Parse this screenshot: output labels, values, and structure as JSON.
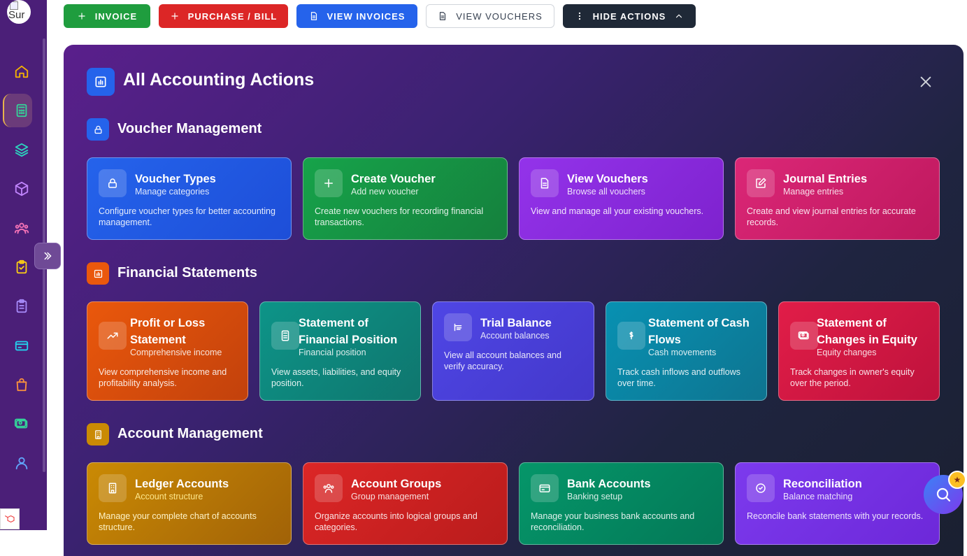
{
  "app": {
    "logo_alt": "Sur"
  },
  "toolbar": {
    "invoice": "INVOICE",
    "purchase": "PURCHASE / BILL",
    "view_invoices": "VIEW INVOICES",
    "view_vouchers": "VIEW VOUCHERS",
    "hide_actions": "HIDE ACTIONS"
  },
  "panel": {
    "title": "All Accounting Actions",
    "sections": {
      "voucher": {
        "title": "Voucher Management",
        "cards": [
          {
            "title": "Voucher Types",
            "subtitle": "Manage categories",
            "desc": "Configure voucher types for better accounting management."
          },
          {
            "title": "Create Voucher",
            "subtitle": "Add new voucher",
            "desc": "Create new vouchers for recording financial transactions."
          },
          {
            "title": "View Vouchers",
            "subtitle": "Browse all vouchers",
            "desc": "View and manage all your existing vouchers."
          },
          {
            "title": "Journal Entries",
            "subtitle": "Manage entries",
            "desc": "Create and view journal entries for accurate records."
          }
        ]
      },
      "financial": {
        "title": "Financial Statements",
        "cards": [
          {
            "title": "Profit or Loss Statement",
            "subtitle": "Comprehensive income",
            "desc": "View comprehensive income and profitability analysis."
          },
          {
            "title": "Statement of Financial Position",
            "subtitle": "Financial position",
            "desc": "View assets, liabilities, and equity position."
          },
          {
            "title": "Trial Balance",
            "subtitle": "Account balances",
            "desc": "View all account balances and verify accuracy."
          },
          {
            "title": "Statement of Cash Flows",
            "subtitle": "Cash movements",
            "desc": "Track cash inflows and outflows over time."
          },
          {
            "title": "Statement of Changes in Equity",
            "subtitle": "Equity changes",
            "desc": "Track changes in owner's equity over the period."
          }
        ]
      },
      "account": {
        "title": "Account Management",
        "cards": [
          {
            "title": "Ledger Accounts",
            "subtitle": "Account structure",
            "desc": "Manage your complete chart of accounts structure."
          },
          {
            "title": "Account Groups",
            "subtitle": "Group management",
            "desc": "Organize accounts into logical groups and categories."
          },
          {
            "title": "Bank Accounts",
            "subtitle": "Banking setup",
            "desc": "Manage your business bank accounts and reconciliation."
          },
          {
            "title": "Reconciliation",
            "subtitle": "Balance matching",
            "desc": "Reconcile bank statements with your records."
          }
        ]
      }
    }
  },
  "colors": {
    "blue": "#2563eb",
    "green": "#16a34a",
    "purple": "#9333ea",
    "pink": "#db2777",
    "orange": "#ea580c",
    "teal": "#0d9488",
    "indigo": "#4f46e5",
    "cyan": "#0891b2",
    "rose": "#e11d48",
    "amber": "#ca8a04",
    "red": "#dc2626",
    "emerald": "#059669",
    "violet": "#7c3aed"
  }
}
